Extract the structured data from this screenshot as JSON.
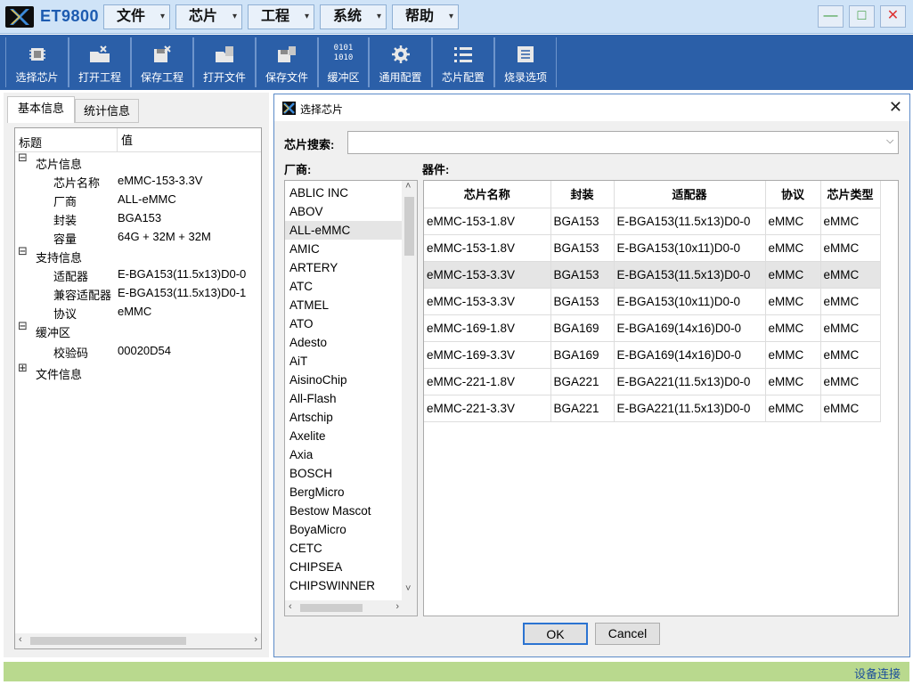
{
  "app": {
    "title": "ET9800"
  },
  "menus": [
    {
      "label": "文件"
    },
    {
      "label": "芯片"
    },
    {
      "label": "工程"
    },
    {
      "label": "系统"
    },
    {
      "label": "帮助"
    }
  ],
  "window_controls": {
    "minimize": "—",
    "maximize": "□",
    "close": "✕"
  },
  "toolbar": [
    {
      "label": "选择芯片",
      "icon": "chip-icon"
    },
    {
      "label": "打开工程",
      "icon": "open-project-icon"
    },
    {
      "label": "保存工程",
      "icon": "save-project-icon"
    },
    {
      "label": "打开文件",
      "icon": "open-file-icon"
    },
    {
      "label": "保存文件",
      "icon": "save-file-icon"
    },
    {
      "label": "缓冲区",
      "icon": "buffer-icon",
      "icon_text": "0101\n1010"
    },
    {
      "label": "通用配置",
      "icon": "gear-icon"
    },
    {
      "label": "芯片配置",
      "icon": "list-icon"
    },
    {
      "label": "烧录选项",
      "icon": "options-icon"
    }
  ],
  "left_panel": {
    "tabs": [
      "基本信息",
      "统计信息"
    ],
    "columns": [
      "标题",
      "值"
    ],
    "rows": [
      {
        "type": "group",
        "sign": "⊟",
        "key": "芯片信息"
      },
      {
        "type": "item",
        "key": "芯片名称",
        "value": "eMMC-153-3.3V"
      },
      {
        "type": "item",
        "key": "厂商",
        "value": "ALL-eMMC"
      },
      {
        "type": "item",
        "key": "封装",
        "value": "BGA153"
      },
      {
        "type": "item",
        "key": "容量",
        "value": "64G + 32M + 32M"
      },
      {
        "type": "group",
        "sign": "⊟",
        "key": "支持信息"
      },
      {
        "type": "item",
        "key": "适配器",
        "value": "E-BGA153(11.5x13)D0-0"
      },
      {
        "type": "item",
        "key": "兼容适配器",
        "value": "E-BGA153(11.5x13)D0-1"
      },
      {
        "type": "item",
        "key": "协议",
        "value": "eMMC"
      },
      {
        "type": "group",
        "sign": "⊟",
        "key": "缓冲区"
      },
      {
        "type": "item",
        "key": "校验码",
        "value": "00020D54"
      },
      {
        "type": "group",
        "sign": "⊞",
        "key": "文件信息"
      }
    ]
  },
  "status": {
    "text": "设备连接"
  },
  "dialog": {
    "title": "选择芯片",
    "search_label": "芯片搜索:",
    "search_value": "",
    "vendor_label": "厂商:",
    "device_label": "器件:",
    "vendors": [
      "ABLIC INC",
      "ABOV",
      "ALL-eMMC",
      "AMIC",
      "ARTERY",
      "ATC",
      "ATMEL",
      "ATO",
      "Adesto",
      "AiT",
      "AisinoChip",
      "All-Flash",
      "Artschip",
      "Axelite",
      "Axia",
      "BOSCH",
      "BergMicro",
      "Bestow Mascot",
      "BoyaMicro",
      "CETC",
      "CHIPSEA",
      "CHIPSWINNER"
    ],
    "selected_vendor": "ALL-eMMC",
    "table": {
      "columns": [
        "芯片名称",
        "封装",
        "适配器",
        "协议",
        "芯片类型"
      ],
      "rows": [
        [
          "eMMC-153-1.8V",
          "BGA153",
          "E-BGA153(11.5x13)D0-0",
          "eMMC",
          "eMMC"
        ],
        [
          "eMMC-153-1.8V",
          "BGA153",
          "E-BGA153(10x11)D0-0",
          "eMMC",
          "eMMC"
        ],
        [
          "eMMC-153-3.3V",
          "BGA153",
          "E-BGA153(11.5x13)D0-0",
          "eMMC",
          "eMMC"
        ],
        [
          "eMMC-153-3.3V",
          "BGA153",
          "E-BGA153(10x11)D0-0",
          "eMMC",
          "eMMC"
        ],
        [
          "eMMC-169-1.8V",
          "BGA169",
          "E-BGA169(14x16)D0-0",
          "eMMC",
          "eMMC"
        ],
        [
          "eMMC-169-3.3V",
          "BGA169",
          "E-BGA169(14x16)D0-0",
          "eMMC",
          "eMMC"
        ],
        [
          "eMMC-221-1.8V",
          "BGA221",
          "E-BGA221(11.5x13)D0-0",
          "eMMC",
          "eMMC"
        ],
        [
          "eMMC-221-3.3V",
          "BGA221",
          "E-BGA221(11.5x13)D0-0",
          "eMMC",
          "eMMC"
        ]
      ],
      "selected_row": 2
    },
    "ok_label": "OK",
    "cancel_label": "Cancel"
  }
}
